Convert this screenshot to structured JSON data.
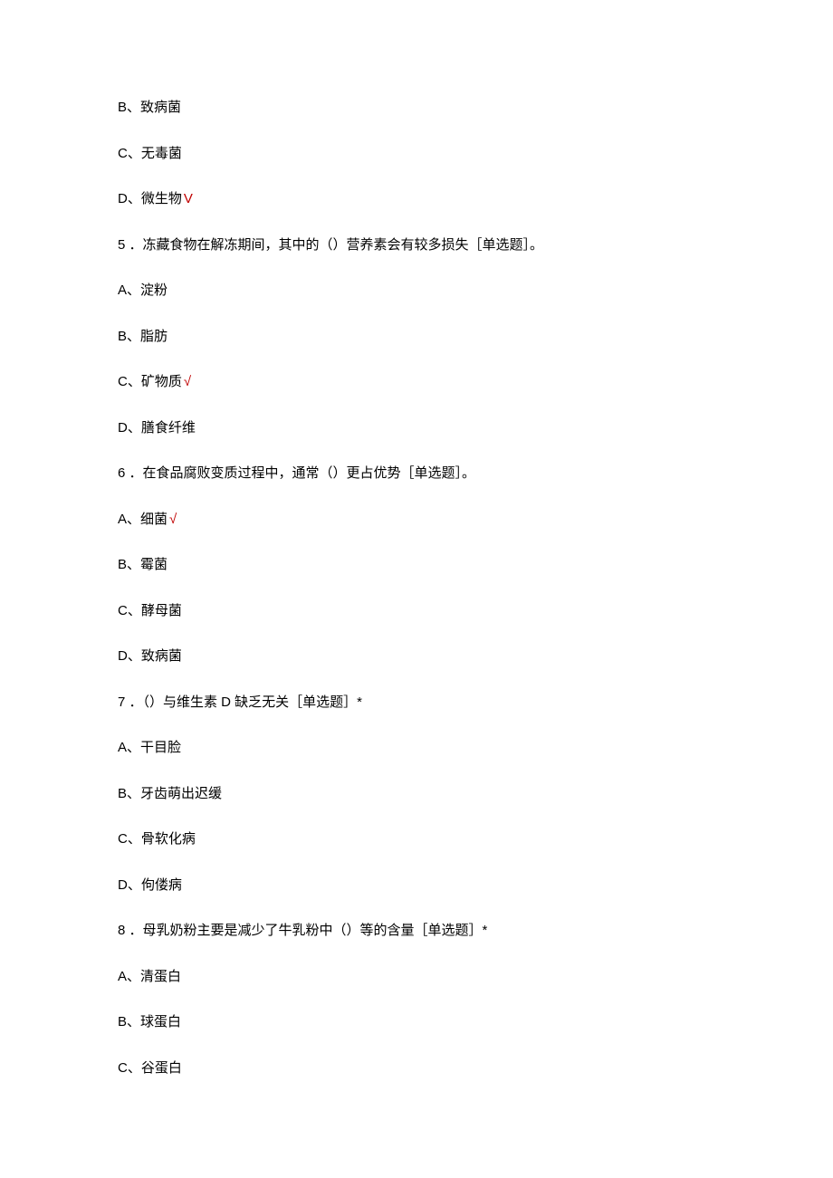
{
  "lines": [
    {
      "prefix": "B、",
      "text": "致病菌",
      "correct": false
    },
    {
      "prefix": "C、",
      "text": "无毒菌",
      "correct": false
    },
    {
      "prefix": "D、",
      "text": "微生物",
      "correct": true,
      "mark": "V"
    },
    {
      "prefix": "5 ．",
      "text": "冻藏食物在解冻期间，其中的（）营养素会有较多损失［单选题］。",
      "correct": false
    },
    {
      "prefix": "A、",
      "text": "淀粉",
      "correct": false
    },
    {
      "prefix": "B、",
      "text": "脂肪",
      "correct": false
    },
    {
      "prefix": "C、",
      "text": "矿物质",
      "correct": true,
      "mark": "√"
    },
    {
      "prefix": "D、",
      "text": "膳食纤维",
      "correct": false
    },
    {
      "prefix": "6 ．",
      "text": "在食品腐败变质过程中，通常（）更占优势［单选题］。",
      "correct": false
    },
    {
      "prefix": "A、",
      "text": "细菌",
      "correct": true,
      "mark": "√"
    },
    {
      "prefix": "B、",
      "text": "霉菌",
      "correct": false
    },
    {
      "prefix": "C、",
      "text": "酵母菌",
      "correct": false
    },
    {
      "prefix": "D、",
      "text": "致病菌",
      "correct": false
    },
    {
      "prefix": "7 ．",
      "text": "（）与维生素 D 缺乏无关［单选题］*",
      "correct": false
    },
    {
      "prefix": "A、",
      "text": "干目脸",
      "correct": false
    },
    {
      "prefix": "B、",
      "text": "牙齿萌出迟缓",
      "correct": false
    },
    {
      "prefix": "C、",
      "text": "骨软化病",
      "correct": false
    },
    {
      "prefix": "D、",
      "text": "佝偻病",
      "correct": false
    },
    {
      "prefix": "8 ．",
      "text": "母乳奶粉主要是减少了牛乳粉中（）等的含量［单选题］*",
      "correct": false
    },
    {
      "prefix": "A、",
      "text": "清蛋白",
      "correct": false
    },
    {
      "prefix": "B、",
      "text": "球蛋白",
      "correct": false
    },
    {
      "prefix": "C、",
      "text": "谷蛋白",
      "correct": false
    }
  ]
}
